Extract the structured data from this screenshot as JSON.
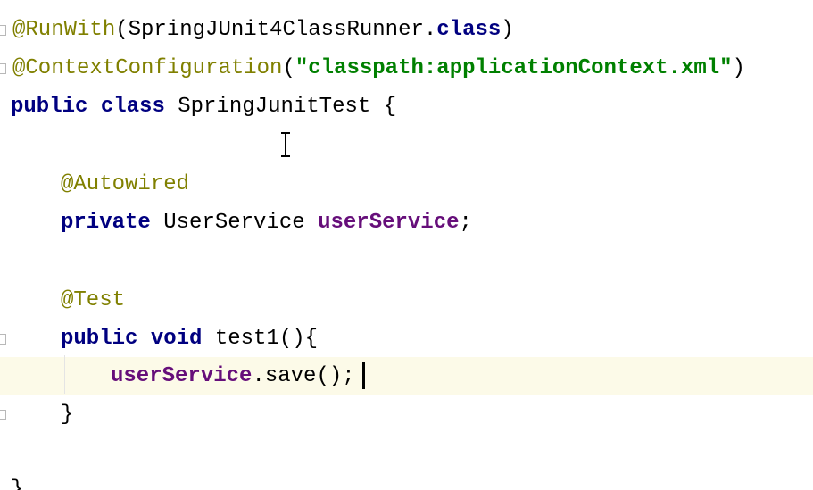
{
  "code": {
    "line1": {
      "annotation": "@RunWith",
      "open_paren": "(",
      "runner": "SpringJUnit4ClassRunner.",
      "class_kw": "class",
      "close_paren": ")"
    },
    "line2": {
      "annotation": "@ContextConfiguration",
      "open_paren": "(",
      "string": "\"classpath:applicationContext.xml\"",
      "close_paren": ")"
    },
    "line3": {
      "public_kw": "public",
      "class_kw": "class",
      "class_name": "SpringJunitTest {"
    },
    "line5": {
      "annotation": "@Autowired"
    },
    "line6": {
      "private_kw": "private",
      "type": "UserService",
      "field": "userService",
      "semicolon": ";"
    },
    "line8": {
      "annotation": "@Test"
    },
    "line9": {
      "public_kw": "public",
      "void_kw": "void",
      "method": "test1(){"
    },
    "line10": {
      "field": "userService",
      "call": ".save();"
    },
    "line11": {
      "brace": "}"
    },
    "line13": {
      "brace": "}"
    }
  },
  "colors": {
    "annotation": "#808000",
    "keyword": "#000080",
    "string": "#008000",
    "field": "#660e7a",
    "current_line": "#fcfae8"
  }
}
